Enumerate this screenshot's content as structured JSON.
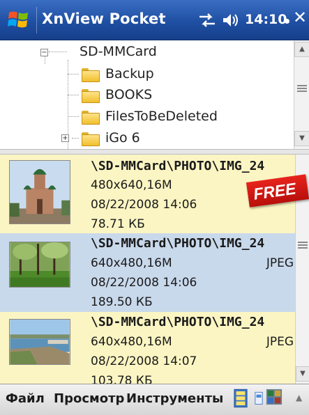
{
  "titlebar": {
    "app_title": "XnView Pocket",
    "time": "14:10",
    "close_label": "✕"
  },
  "tree": {
    "root": "SD-MMCard",
    "root_expander": "−",
    "items": [
      {
        "label": "Backup"
      },
      {
        "label": "BOOKS"
      },
      {
        "label": "FilesToBeDeleted"
      },
      {
        "label": "iGo 6",
        "expander": "+"
      }
    ]
  },
  "files": [
    {
      "path": "\\SD-MMCard\\PHOTO\\IMG_24",
      "dimensions": "480x640,16M",
      "format": "",
      "date": "08/22/2008 14:06",
      "size": "78.71 КБ",
      "bg": "#fbf5c3"
    },
    {
      "path": "\\SD-MMCard\\PHOTO\\IMG_24",
      "dimensions": "640x480,16M",
      "format": "JPEG",
      "date": "08/22/2008 14:06",
      "size": "189.50 КБ",
      "bg": "#c9d9ec"
    },
    {
      "path": "\\SD-MMCard\\PHOTO\\IMG_24",
      "dimensions": "640x480,16M",
      "format": "JPEG",
      "date": "08/22/2008 14:07",
      "size": "103.78 КБ",
      "bg": "#fbf5c3"
    }
  ],
  "badge": {
    "label": "FREE"
  },
  "menubar": {
    "file": "Файл",
    "view": "Просмотр",
    "tools": "Инструменты"
  },
  "colors": {
    "titlebar": "#1f4fa3",
    "row_yellow": "#fbf5c3",
    "row_blue": "#c9d9ec",
    "badge_red": "#d41a14"
  }
}
